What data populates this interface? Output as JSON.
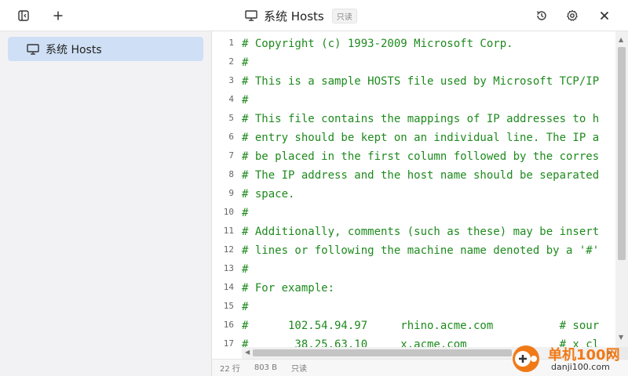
{
  "titlebar": {
    "title": "系统 Hosts",
    "readonly_badge": "只读",
    "icons": [
      "sidebar-toggle-icon",
      "plus-icon",
      "monitor-icon",
      "history-icon",
      "gear-icon",
      "close-icon"
    ]
  },
  "sidebar": {
    "items": [
      {
        "label": "系统 Hosts",
        "icon": "monitor-icon",
        "selected": true
      }
    ]
  },
  "editor": {
    "line_numbers": [
      "1",
      "2",
      "3",
      "4",
      "5",
      "6",
      "7",
      "8",
      "9",
      "10",
      "11",
      "12",
      "13",
      "14",
      "15",
      "16",
      "17"
    ],
    "lines": [
      "# Copyright (c) 1993-2009 Microsoft Corp.",
      "#",
      "# This is a sample HOSTS file used by Microsoft TCP/IP",
      "#",
      "# This file contains the mappings of IP addresses to h",
      "# entry should be kept on an individual line. The IP a",
      "# be placed in the first column followed by the corres",
      "# The IP address and the host name should be separated",
      "# space.",
      "#",
      "# Additionally, comments (such as these) may be insert",
      "# lines or following the machine name denoted by a '#'",
      "#",
      "# For example:",
      "#",
      "#      102.54.94.97     rhino.acme.com          # sour",
      "#       38.25.63.10     x.acme.com              # x cl"
    ],
    "text_color": "#1e8a1e"
  },
  "statusbar": {
    "lines": "22 行",
    "size": "803 B",
    "mode": "只读"
  },
  "watermark": {
    "brand": "单机100网",
    "url": "danji100.com"
  },
  "colors": {
    "sidebar_bg": "#f2f2f4",
    "selected_bg": "#cfdff5",
    "comment_green": "#1e8a1e",
    "watermark_orange": "#f07a18"
  }
}
